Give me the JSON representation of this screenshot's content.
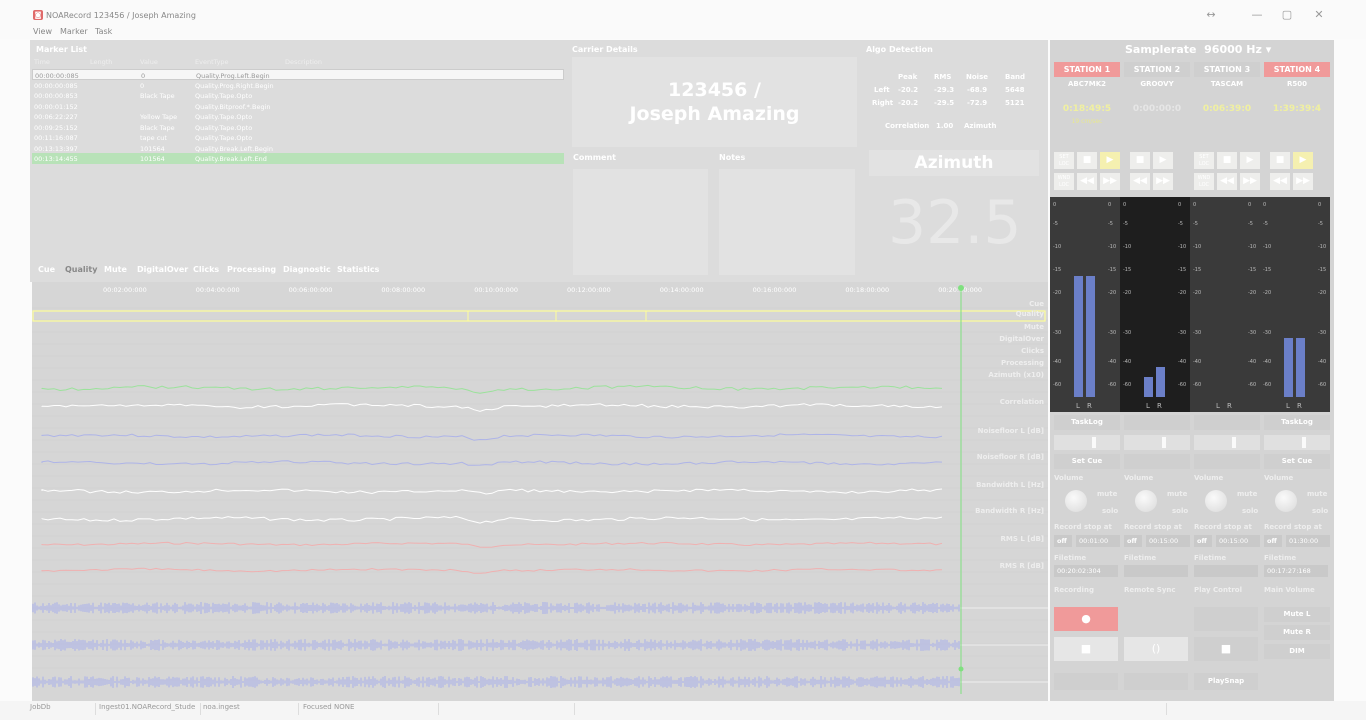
{
  "window": {
    "title": "NOARecord 123456 / Joseph Amazing",
    "restore": "↔",
    "minimize": "—",
    "maximize": "▢",
    "close": "✕"
  },
  "menu": [
    "View",
    "Marker",
    "Task"
  ],
  "marker_list": {
    "title": "Marker List",
    "columns": [
      "Time",
      "Length",
      "Value",
      "EventType",
      "Description"
    ],
    "rows": [
      {
        "time": "00:00:00:085",
        "length": "",
        "value": "0",
        "event": "Quality.Prog.Left.Begin",
        "style": "sel"
      },
      {
        "time": "00:00:00:085",
        "length": "",
        "value": "0",
        "event": "Quality.Prog.Right.Begin",
        "style": ""
      },
      {
        "time": "00:00:00:853",
        "length": "",
        "value": "Black Tape",
        "event": "Quality.Tape.Opto",
        "style": ""
      },
      {
        "time": "00:00:01:152",
        "length": "",
        "value": "",
        "event": "Quality.Bitproof.*.Begin",
        "style": ""
      },
      {
        "time": "00:06:22:227",
        "length": "",
        "value": "Yellow Tape",
        "event": "Quality.Tape.Opto",
        "style": ""
      },
      {
        "time": "00:09:25:152",
        "length": "",
        "value": "Black Tape",
        "event": "Quality.Tape.Opto",
        "style": ""
      },
      {
        "time": "00:11:16:087",
        "length": "",
        "value": "tape cut",
        "event": "Quality.Tape.Opto",
        "style": ""
      },
      {
        "time": "00:13:13:397",
        "length": "",
        "value": "101564",
        "event": "Quality.Break.Left.Begin",
        "style": ""
      },
      {
        "time": "00:13:14:455",
        "length": "",
        "value": "101564",
        "event": "Quality.Break.Left.End",
        "style": "green"
      }
    ]
  },
  "tabs": [
    "Cue",
    "Quality",
    "Mute",
    "DigitalOver",
    "Clicks",
    "Processing",
    "Diagnostic",
    "Statistics"
  ],
  "active_tab": "Quality",
  "carrier": {
    "title": "Carrier Details",
    "line1": "123456 /",
    "line2": "Joseph Amazing"
  },
  "comment_title": "Comment",
  "notes_title": "Notes",
  "algo": {
    "title": "Algo Detection",
    "headers": [
      "Peak",
      "RMS",
      "Noise",
      "Band"
    ],
    "left_label": "Left",
    "right_label": "Right",
    "left": [
      "-20.2",
      "-29.3",
      "-68.9",
      "5648"
    ],
    "right": [
      "-20.2",
      "-29.5",
      "-72.9",
      "5121"
    ],
    "correlation_label": "Correlation",
    "correlation": "1.00",
    "azimuth_label": "Azimuth"
  },
  "azimuth": {
    "title": "Azimuth",
    "value": "32.5"
  },
  "timeline": {
    "ticks": [
      "00:02:00:000",
      "00:04:00:000",
      "00:06:00:000",
      "00:08:00:000",
      "00:10:00:000",
      "00:12:00:000",
      "00:14:00:000",
      "00:16:00:000",
      "00:18:00:000",
      "00:20:00:000"
    ],
    "lanes": [
      "Cue",
      "Quality",
      "Mute",
      "DigitalOver",
      "Clicks",
      "Processing",
      "Azimuth (x10)",
      "Correlation",
      "Noisefloor L [dB]",
      "Noisefloor R [dB]",
      "Bandwidth L [Hz]",
      "Bandwidth R [Hz]",
      "RMS L [dB]",
      "RMS R [dB]"
    ]
  },
  "samplerate": {
    "label": "Samplerate",
    "value": "96000 Hz",
    "arrow": "▾"
  },
  "stations": [
    {
      "name": "STATION 1",
      "device": "ABC7MK2",
      "time": "0:18:49:5",
      "sub": "19 cm/sec",
      "red": true,
      "volume": "Volume",
      "stop_off": "off",
      "stop_time": "00:01:00",
      "filetime": "00:20:02:304",
      "level_l": 0.68,
      "level_r": 0.68
    },
    {
      "name": "STATION 2",
      "device": "GROOVY",
      "time": "0:00:00:0",
      "sub": "",
      "red": false,
      "volume": "Volume",
      "stop_off": "off",
      "stop_time": "00:15:00",
      "filetime": "",
      "level_l": 0.11,
      "level_r": 0.17
    },
    {
      "name": "STATION 3",
      "device": "TASCAM",
      "time": "0:06:39:0",
      "sub": "",
      "red": false,
      "volume": "Volume",
      "stop_off": "off",
      "stop_time": "00:15:00",
      "filetime": "",
      "level_l": 0,
      "level_r": 0
    },
    {
      "name": "STATION 4",
      "device": "R500",
      "time": "1:39:39:4",
      "sub": "",
      "red": true,
      "volume": "Volume",
      "stop_off": "off",
      "stop_time": "01:30:00",
      "filetime": "00:17:27:168",
      "level_l": 0.33,
      "level_r": 0.33
    }
  ],
  "transport": {
    "set_loc": "SET LOC",
    "wind_loc": "WND LOC",
    "stop": "■",
    "play": "▶",
    "rew": "◀◀",
    "ff": "▶▶"
  },
  "meter": {
    "ticks": [
      "0",
      "-5",
      "-10",
      "-15",
      "-20",
      "-30",
      "-40",
      "-60"
    ],
    "l": "L",
    "r": "R"
  },
  "controls": {
    "tasklog": "TaskLog",
    "setcue": "Set Cue",
    "mute": "mute",
    "solo": "solo",
    "record_stop": "Record stop at",
    "filetime": "Filetime",
    "recording": "Recording",
    "remote_sync": "Remote Sync",
    "play_control": "Play Control",
    "main_volume": "Main Volume",
    "mute_l": "Mute L",
    "mute_r": "Mute R",
    "dim": "DIM",
    "playsnap": "PlaySnap",
    "rec_symbol": "●",
    "stop_symbol": "■",
    "sync_symbol": "()"
  },
  "status": {
    "jobdb": "JobDb",
    "ingest": "Ingest01.NOARecord_Stude",
    "noa": "noa.ingest",
    "focused": "Focused NONE"
  },
  "colors": {
    "green_wave": "#9be29b",
    "blue_wave": "#aeb4e8",
    "red_wave": "#f0b0b0",
    "cursor": "#7fe07f",
    "quality": "#ffff99",
    "meter_bar": "#6b7fc8",
    "station_red": "#f09a9a"
  }
}
